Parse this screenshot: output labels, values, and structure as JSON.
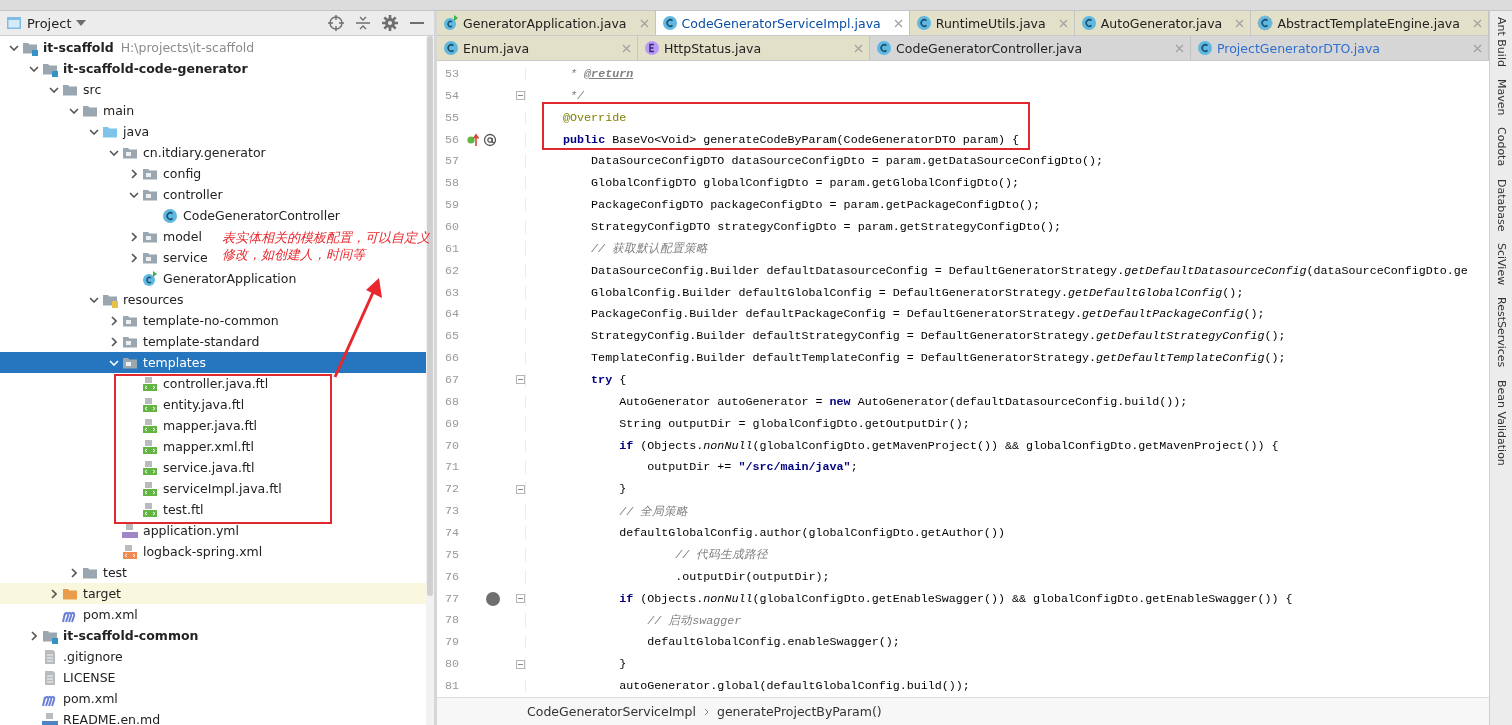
{
  "project_panel": {
    "title": "Project",
    "tree": [
      {
        "name": "it-scaffold",
        "kind": "module",
        "path": "H:\\projects\\it-scaffold",
        "expanded": true,
        "selected": false,
        "children": [
          {
            "name": "it-scaffold-code-generator",
            "kind": "module",
            "expanded": true,
            "selected": false,
            "children": [
              {
                "name": "src",
                "kind": "folder",
                "expanded": true,
                "selected": false,
                "children": [
                  {
                    "name": "main",
                    "kind": "folder",
                    "expanded": true,
                    "selected": false,
                    "children": [
                      {
                        "name": "java",
                        "kind": "source-root",
                        "expanded": true,
                        "selected": false,
                        "children": [
                          {
                            "name": "cn.itdiary.generator",
                            "kind": "package",
                            "expanded": true,
                            "selected": false,
                            "children": [
                              {
                                "name": "config",
                                "kind": "package",
                                "expanded": false,
                                "selected": false
                              },
                              {
                                "name": "controller",
                                "kind": "package",
                                "expanded": true,
                                "selected": false,
                                "children": [
                                  {
                                    "name": "CodeGeneratorController",
                                    "kind": "class",
                                    "selected": false
                                  }
                                ]
                              },
                              {
                                "name": "model",
                                "kind": "package",
                                "expanded": false,
                                "selected": false
                              },
                              {
                                "name": "service",
                                "kind": "package",
                                "expanded": false,
                                "selected": false
                              },
                              {
                                "name": "GeneratorApplication",
                                "kind": "app-class",
                                "selected": false
                              }
                            ]
                          }
                        ]
                      },
                      {
                        "name": "resources",
                        "kind": "resource-root",
                        "expanded": true,
                        "selected": false,
                        "children": [
                          {
                            "name": "template-no-common",
                            "kind": "package",
                            "expanded": false,
                            "selected": false
                          },
                          {
                            "name": "template-standard",
                            "kind": "package",
                            "expanded": false,
                            "selected": false
                          },
                          {
                            "name": "templates",
                            "kind": "package",
                            "expanded": true,
                            "selected": true,
                            "children": [
                              {
                                "name": "controller.java.ftl",
                                "kind": "ftl",
                                "selected": false
                              },
                              {
                                "name": "entity.java.ftl",
                                "kind": "ftl",
                                "selected": false
                              },
                              {
                                "name": "mapper.java.ftl",
                                "kind": "ftl",
                                "selected": false
                              },
                              {
                                "name": "mapper.xml.ftl",
                                "kind": "ftl",
                                "selected": false
                              },
                              {
                                "name": "service.java.ftl",
                                "kind": "ftl",
                                "selected": false
                              },
                              {
                                "name": "serviceImpl.java.ftl",
                                "kind": "ftl",
                                "selected": false
                              },
                              {
                                "name": "test.ftl",
                                "kind": "ftl",
                                "selected": false
                              }
                            ]
                          },
                          {
                            "name": "application.yml",
                            "kind": "yml",
                            "selected": false
                          },
                          {
                            "name": "logback-spring.xml",
                            "kind": "xml",
                            "selected": false
                          }
                        ]
                      }
                    ]
                  },
                  {
                    "name": "test",
                    "kind": "folder",
                    "expanded": false,
                    "selected": false
                  }
                ]
              },
              {
                "name": "target",
                "kind": "excluded",
                "expanded": false,
                "selected": false
              },
              {
                "name": "pom.xml",
                "kind": "maven",
                "selected": false
              }
            ]
          },
          {
            "name": "it-scaffold-common",
            "kind": "module",
            "expanded": false,
            "selected": false
          },
          {
            "name": ".gitignore",
            "kind": "text",
            "selected": false
          },
          {
            "name": "LICENSE",
            "kind": "text",
            "selected": false
          },
          {
            "name": "pom.xml",
            "kind": "maven",
            "selected": false
          },
          {
            "name": "README.en.md",
            "kind": "md",
            "selected": false
          }
        ]
      }
    ]
  },
  "editor": {
    "tab_rows": [
      {
        "tabs": [
          {
            "label": "GeneratorApplication.java",
            "kind": "app",
            "selected": false,
            "tinted": true,
            "modified": false
          },
          {
            "label": "CodeGeneratorServiceImpl.java",
            "kind": "class",
            "selected": true,
            "tinted": false,
            "modified": false
          },
          {
            "label": "RuntimeUtils.java",
            "kind": "class",
            "selected": false,
            "tinted": true,
            "modified": false
          },
          {
            "label": "AutoGenerator.java",
            "kind": "class",
            "selected": false,
            "tinted": true,
            "modified": false
          },
          {
            "label": "AbstractTemplateEngine.java",
            "kind": "abstract",
            "selected": false,
            "tinted": true,
            "modified": false
          }
        ]
      },
      {
        "tabs": [
          {
            "label": "Enum.java",
            "kind": "class",
            "selected": false,
            "tinted": true,
            "modified": false
          },
          {
            "label": "HttpStatus.java",
            "kind": "enum",
            "selected": false,
            "tinted": true,
            "modified": false
          },
          {
            "label": "CodeGeneratorController.java",
            "kind": "class",
            "selected": false,
            "tinted": false,
            "modified": false
          },
          {
            "label": "ProjectGeneratorDTO.java",
            "kind": "class",
            "selected": false,
            "tinted": false,
            "modified": true
          }
        ]
      }
    ],
    "lines": [
      {
        "number": "53",
        "kind": "doc",
        "text": "     * **@return**"
      },
      {
        "number": "54",
        "kind": "doc",
        "text": "     */",
        "fold": true
      },
      {
        "number": "55",
        "kind": "annotation",
        "text": "    @Override"
      },
      {
        "number": "56",
        "kind": "code",
        "text": "    **public** BaseVo<Void> generateCodeByParam(CodeGeneratorDTO param) {",
        "gutter": {
          "kind": "override"
        }
      },
      {
        "number": "57",
        "kind": "code",
        "text": "        DataSourceConfigDTO dataSourceConfigDto = param.getDataSourceConfigDto();"
      },
      {
        "number": "58",
        "kind": "code",
        "text": "        GlobalConfigDTO globalConfigDto = param.getGlobalConfigDto();"
      },
      {
        "number": "59",
        "kind": "code",
        "text": "        PackageConfigDTO packageConfigDto = param.getPackageConfigDto();"
      },
      {
        "number": "60",
        "kind": "code",
        "text": "        StrategyConfigDTO strategyConfigDto = param.getStrategyConfigDto();"
      },
      {
        "number": "61",
        "kind": "comment",
        "text": "        // 获取默认配置策略"
      },
      {
        "number": "62",
        "kind": "code",
        "text": "        DataSourceConfig.Builder defaultDatasourceConfig = DefaultGeneratorStrategy.*getDefaultDatasourceConfig*(dataSourceConfigDto.ge"
      },
      {
        "number": "63",
        "kind": "code",
        "text": "        GlobalConfig.Builder defaultGlobalConfig = DefaultGeneratorStrategy.*getDefaultGlobalConfig*();"
      },
      {
        "number": "64",
        "kind": "code",
        "text": "        PackageConfig.Builder defaultPackageConfig = DefaultGeneratorStrategy.*getDefaultPackageConfig*();"
      },
      {
        "number": "65",
        "kind": "code",
        "text": "        StrategyConfig.Builder defaultStrategyConfig = DefaultGeneratorStrategy.*getDefaultStrategyConfig*();"
      },
      {
        "number": "66",
        "kind": "code",
        "text": "        TemplateConfig.Builder defaultTemplateConfig = DefaultGeneratorStrategy.*getDefaultTemplateConfig*();"
      },
      {
        "number": "67",
        "kind": "code",
        "text": "        **try** {",
        "fold": true
      },
      {
        "number": "68",
        "kind": "code",
        "text": "            AutoGenerator autoGenerator = **new** AutoGenerator(defaultDatasourceConfig.build());"
      },
      {
        "number": "69",
        "kind": "code",
        "text": "            String outputDir = globalConfigDto.getOutputDir();"
      },
      {
        "number": "70",
        "kind": "code",
        "text": "            **if** (Objects.*nonNull*(globalConfigDto.getMavenProject()) && globalConfigDto.getMavenProject()) {"
      },
      {
        "number": "71",
        "kind": "code",
        "text": "                outputDir += **\"/src/main/java\"**;"
      },
      {
        "number": "72",
        "kind": "code",
        "text": "            }",
        "fold": true
      },
      {
        "number": "73",
        "kind": "comment",
        "text": "            // 全局策略"
      },
      {
        "number": "74",
        "kind": "code",
        "text": "            defaultGlobalConfig.author(globalConfigDto.getAuthor())"
      },
      {
        "number": "75",
        "kind": "comment",
        "text": "                    // 代码生成路径"
      },
      {
        "number": "76",
        "kind": "code",
        "text": "                    .outputDir(outputDir);"
      },
      {
        "number": "77",
        "kind": "code",
        "text": "            **if** (Objects.*nonNull*(globalConfigDto.getEnableSwagger()) && globalConfigDto.getEnableSwagger()) {",
        "gutter": {
          "kind": "breakpoint"
        },
        "fold": true
      },
      {
        "number": "78",
        "kind": "comment",
        "text": "                // 启动swagger"
      },
      {
        "number": "79",
        "kind": "code",
        "text": "                defaultGlobalConfig.enableSwagger();"
      },
      {
        "number": "80",
        "kind": "code",
        "text": "            }",
        "fold": true
      },
      {
        "number": "81",
        "kind": "code",
        "text": "            autoGenerator.global(defaultGlobalConfig.build());"
      }
    ],
    "breadcrumb": [
      "CodeGeneratorServiceImpl",
      "generateProjectByParam()"
    ]
  },
  "tool_strip": [
    "Ant Build",
    "Maven",
    "Codota",
    "Database",
    "SciView",
    "RestServices",
    "Bean Validation"
  ],
  "annotation": {
    "note": "表实体相关的模板配置，可以自定义修改，如创建人，时间等"
  }
}
